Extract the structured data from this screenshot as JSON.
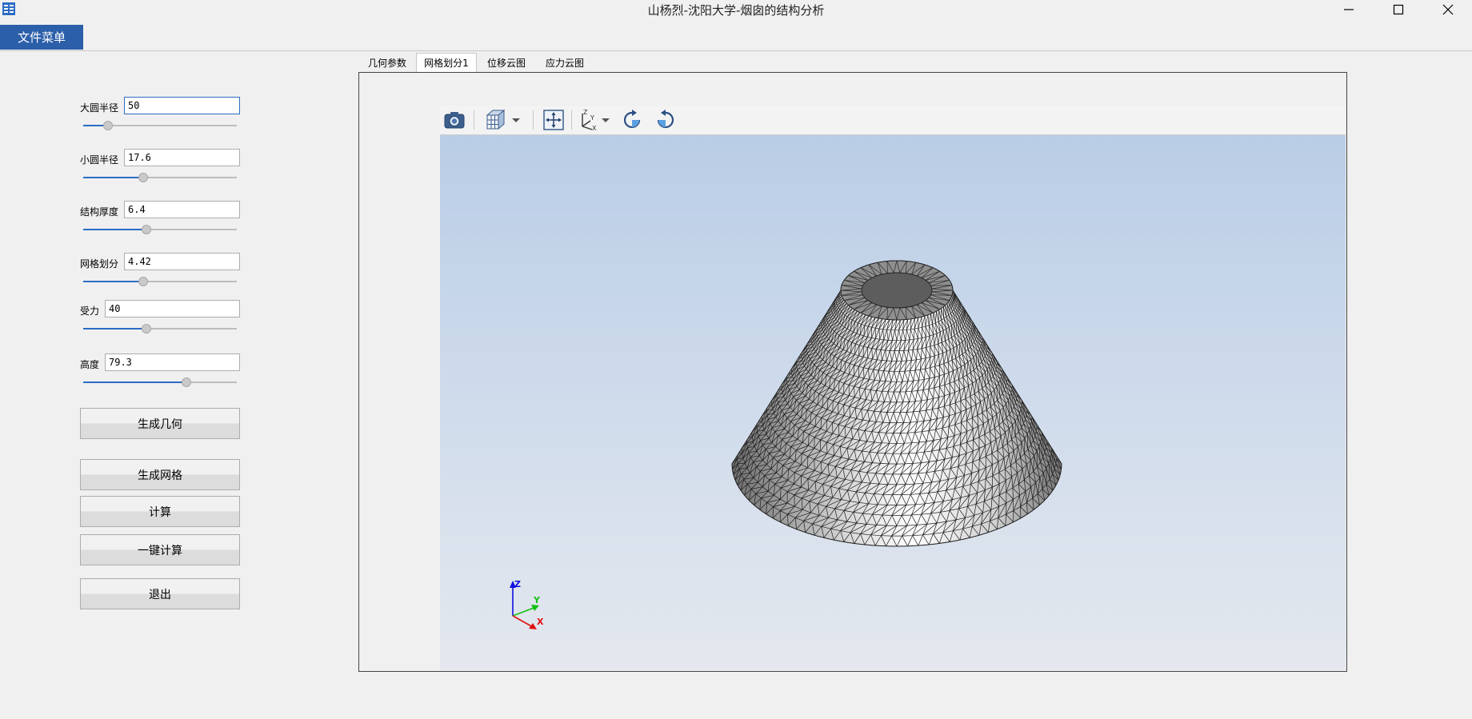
{
  "window": {
    "title": "山杨烈-沈阳大学-烟囱的结构分析",
    "minimize_glyph": "—",
    "maximize_glyph": "☐",
    "close_glyph": "✕"
  },
  "menu": {
    "file_menu_label": "文件菜单"
  },
  "params": [
    {
      "label": "大圆半径",
      "value": "50",
      "slider_fraction": 0.16
    },
    {
      "label": "小圆半径",
      "value": "17.6",
      "slider_fraction": 0.39
    },
    {
      "label": "结构厚度",
      "value": "6.4",
      "slider_fraction": 0.41
    },
    {
      "label": "网格划分",
      "value": "4.42",
      "slider_fraction": 0.39
    },
    {
      "label": "受力",
      "value": "40",
      "slider_fraction": 0.41
    },
    {
      "label": "高度",
      "value": "79.3",
      "slider_fraction": 0.67
    }
  ],
  "buttons": {
    "generate_geometry": "生成几何",
    "generate_mesh": "生成网格",
    "compute": "计算",
    "one_click_compute": "一键计算",
    "exit": "退出"
  },
  "tabs": [
    {
      "label": "几何参数",
      "active": false
    },
    {
      "label": "网格划分1",
      "active": true
    },
    {
      "label": "位移云图",
      "active": false
    },
    {
      "label": "应力云图",
      "active": false
    }
  ],
  "viewer": {
    "toolbar_icons": [
      "camera-icon",
      "view-cube-icon",
      "fit-all-icon",
      "axes-icon",
      "rotate-clockwise-icon",
      "rotate-counterclockwise-icon"
    ],
    "axis_labels": {
      "x": "X",
      "y": "Y",
      "z": "Z"
    },
    "axis_colors": {
      "x": "#e01010",
      "y": "#12c012",
      "z": "#1010e0"
    },
    "background_top": "#b9cde6",
    "background_bottom": "#e4e8ee"
  }
}
